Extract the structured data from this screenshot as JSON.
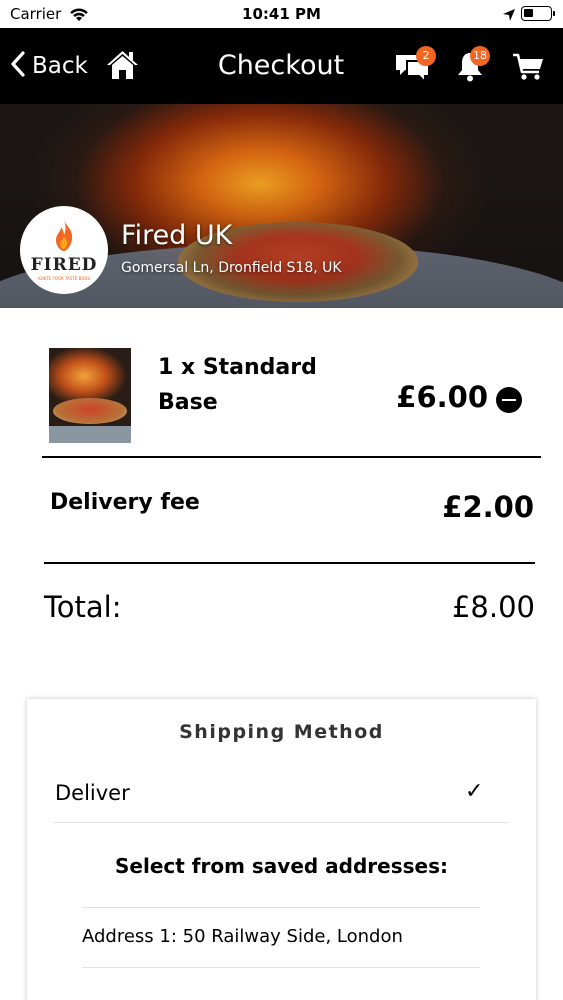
{
  "status_bar": {
    "carrier": "Carrier",
    "time": "10:41 PM"
  },
  "nav": {
    "back_label": "Back",
    "title": "Checkout",
    "chat_badge": "2",
    "notification_badge": "18",
    "icons": [
      "chevron-left-icon",
      "home-icon",
      "chat-icon",
      "bell-icon",
      "cart-icon"
    ],
    "badge_color": "#f26522"
  },
  "store": {
    "name": "Fired UK",
    "address": "Gomersal Ln, Dronfield S18, UK",
    "logo": {
      "brand": "FIRED",
      "tagline": "IGNITE YOUR TASTE BUDS"
    }
  },
  "order": {
    "items": [
      {
        "name": "1 x Standard Base",
        "price": "£6.00"
      }
    ],
    "delivery_fee_label": "Delivery fee",
    "delivery_fee": "£2.00",
    "total_label": "Total:",
    "total": "£8.00"
  },
  "shipping": {
    "title": "Shipping Method",
    "selected_method": "Deliver",
    "saved_addresses_title": "Select from saved addresses:",
    "addresses": [
      "Address 1: 50 Railway Side, London"
    ]
  },
  "colors": {
    "nav_background": "#000000",
    "accent": "#f26522"
  }
}
